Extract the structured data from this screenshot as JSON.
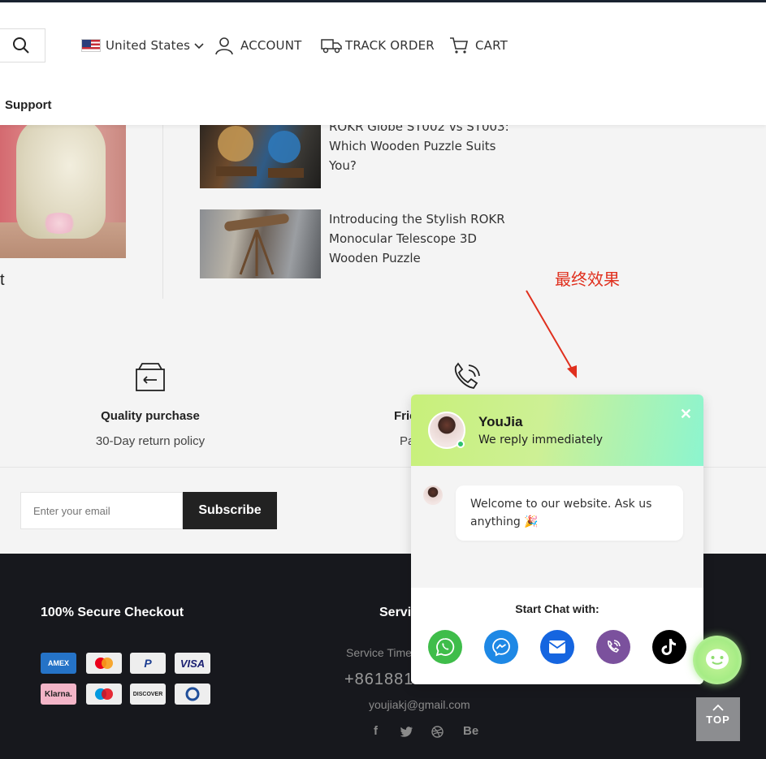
{
  "header": {
    "country": "United States",
    "account": "ACCOUNT",
    "track_order": "TRACK ORDER",
    "cart": "CART",
    "support": "Support"
  },
  "content": {
    "partial_text": "t",
    "posts": [
      {
        "title": "ROKR Globe ST002 vs ST003: Which Wooden Puzzle Suits You?"
      },
      {
        "title": "Introducing the Stylish ROKR Monocular Telescope 3D Wooden Puzzle"
      }
    ],
    "annotation": "最终效果"
  },
  "features": [
    {
      "title": "Quality purchase",
      "sub": "30-Day return policy"
    },
    {
      "title": "Frie",
      "sub": "Pa"
    }
  ],
  "newsletter": {
    "placeholder": "Enter your email",
    "button": "Subscribe"
  },
  "footer": {
    "secure_title": "100% Secure Checkout",
    "payments": [
      "AMEX",
      "Mastercard",
      "PayPal",
      "VISA",
      "Klarna.",
      "Maestro",
      "DISCOVER",
      "Diners Club"
    ],
    "service_title": "Servi",
    "service_time": "Service Time",
    "phone": "+8618810",
    "email": "youjiakj@gmail.com",
    "social": [
      "f",
      "twitter",
      "dribbble",
      "Be"
    ]
  },
  "chat": {
    "name": "YouJia",
    "subtitle": "We reply immediately",
    "message": "Welcome to our website. Ask us anything 🎉",
    "start_label": "Start Chat with:",
    "channels": [
      "whatsapp",
      "messenger",
      "email",
      "viber",
      "tiktok"
    ],
    "colors": {
      "whatsapp": "#3fbd4a",
      "messenger": "#1e88e5",
      "email": "#1565e0",
      "viber": "#7b519d",
      "tiktok": "#000000"
    }
  },
  "top_button": "TOP"
}
